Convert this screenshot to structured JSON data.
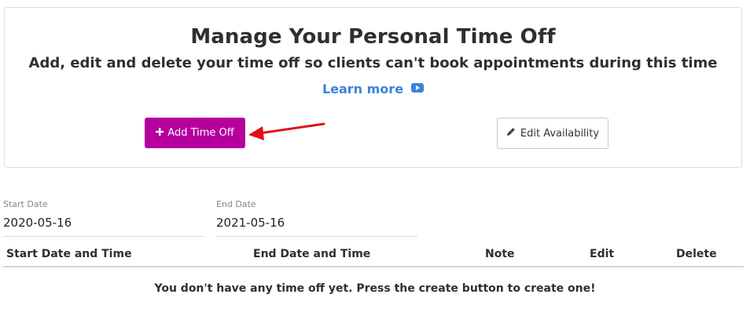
{
  "header": {
    "title": "Manage Your Personal Time Off",
    "subtitle": "Add, edit and delete your time off so clients can't book appointments during this time",
    "learn_more": "Learn more"
  },
  "actions": {
    "add_time_off": "Add Time Off",
    "edit_availability": "Edit Availability"
  },
  "filters": {
    "start_date": {
      "label": "Start Date",
      "value": "2020-05-16"
    },
    "end_date": {
      "label": "End Date",
      "value": "2021-05-16"
    }
  },
  "table": {
    "columns": [
      "Start Date and Time",
      "End Date and Time",
      "Note",
      "Edit",
      "Delete"
    ],
    "empty_message": "You don't have any time off yet. Press the create button to create one!"
  },
  "colors": {
    "primary_button": "#b5009e",
    "link": "#3b82d9",
    "annotation_arrow": "#e0101a"
  },
  "icons": {
    "learn_more": "youtube-play-icon",
    "add": "plus-icon",
    "edit": "pencil-icon",
    "annotation": "red-arrow-icon"
  }
}
